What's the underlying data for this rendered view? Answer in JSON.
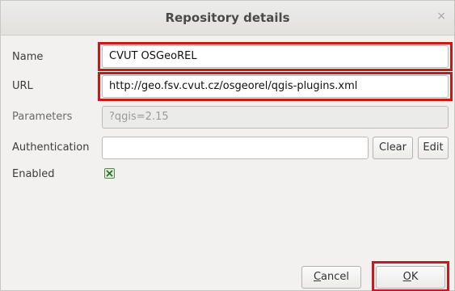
{
  "window": {
    "title": "Repository details",
    "close_glyph": "×"
  },
  "form": {
    "name_label": "Name",
    "name_value": "CVUT OSGeoREL",
    "url_label": "URL",
    "url_value": "http://geo.fsv.cvut.cz/osgeorel/qgis-plugins.xml",
    "parameters_label": "Parameters",
    "parameters_value": "?qgis=2.15",
    "authentication_label": "Authentication",
    "authentication_value": "",
    "clear_label": "Clear",
    "edit_label": "Edit",
    "enabled_label": "Enabled",
    "enabled_checked": true
  },
  "buttons": {
    "cancel_mnemonic": "C",
    "cancel_rest": "ancel",
    "ok_mnemonic": "O",
    "ok_rest": "K"
  },
  "colors": {
    "highlight": "#c41a1a",
    "checkbox_bg": "#d9ecd4"
  }
}
